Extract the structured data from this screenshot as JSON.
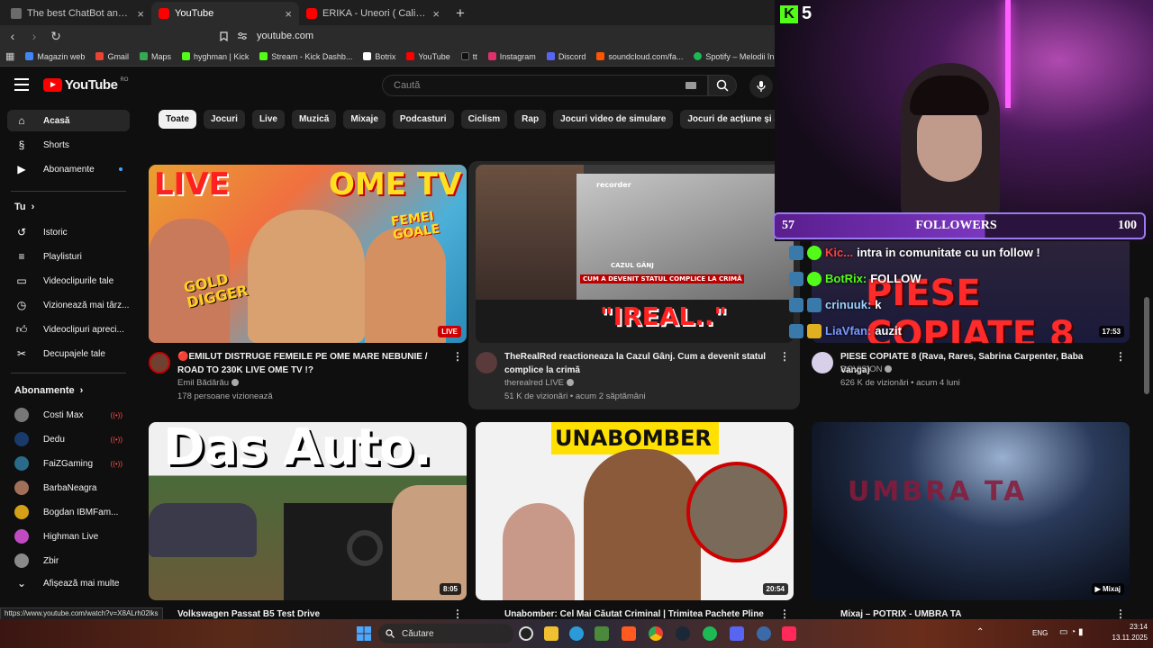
{
  "browser": {
    "tabs": [
      {
        "title": "The best ChatBot and Widgets for Kick",
        "color": "#6b6b6b"
      },
      {
        "title": "YouTube",
        "color": "#ff0000"
      },
      {
        "title": "ERIKA - Uneori ( Calinacho cover ) - YouTube",
        "color": "#ff0000"
      }
    ],
    "address": "youtube.com",
    "bookmarks": [
      {
        "label": "Magazin web",
        "color": "#4285f4"
      },
      {
        "label": "Gmail",
        "color": "#ea4335"
      },
      {
        "label": "Maps",
        "color": "#34a853"
      },
      {
        "label": "hyghman | Kick",
        "color": "#53fc18"
      },
      {
        "label": "Stream - Kick Dashb...",
        "color": "#53fc18"
      },
      {
        "label": "Botrix",
        "color": "#ffffff"
      },
      {
        "label": "YouTube",
        "color": "#ff0000"
      },
      {
        "label": "tt",
        "color": "#111111"
      },
      {
        "label": "Instagram",
        "color": "#e1306c"
      },
      {
        "label": "Discord",
        "color": "#5865f2"
      },
      {
        "label": "soundcloud.com/fa...",
        "color": "#ff5500"
      },
      {
        "label": "Spotify – Melodii în...",
        "color": "#1db954"
      }
    ]
  },
  "masthead": {
    "logo": "YouTube",
    "country": "RO",
    "search_placeholder": "Caută"
  },
  "sidebar": {
    "main": [
      {
        "label": "Acasă",
        "icon": "home-icon"
      },
      {
        "label": "Shorts",
        "icon": "shorts-icon"
      },
      {
        "label": "Abonamente",
        "icon": "subscriptions-icon"
      }
    ],
    "you_heading": "Tu",
    "you": [
      {
        "label": "Istoric",
        "icon": "history-icon"
      },
      {
        "label": "Playlisturi",
        "icon": "playlist-icon"
      },
      {
        "label": "Videoclipurile tale",
        "icon": "your-videos-icon"
      },
      {
        "label": "Vizionează mai târz...",
        "icon": "watch-later-icon"
      },
      {
        "label": "Videoclipuri apreci...",
        "icon": "liked-icon"
      },
      {
        "label": "Decupajele tale",
        "icon": "clips-icon"
      }
    ],
    "subs_heading": "Abonamente",
    "subs": [
      {
        "label": "Costi Max",
        "color": "#777777",
        "live": "((•))"
      },
      {
        "label": "Dedu",
        "color": "#1a3a6a",
        "live": "((•))"
      },
      {
        "label": "FaiZGaming",
        "color": "#2a6a8a",
        "live": "((•))"
      },
      {
        "label": "BarbaNeagra",
        "color": "#a0705a",
        "live": ""
      },
      {
        "label": "Bogdan IBMFam...",
        "color": "#d4a017",
        "live": ""
      },
      {
        "label": "Highman Live",
        "color": "#c04ac0",
        "live": ""
      },
      {
        "label": "Zbir",
        "color": "#8a8a8a",
        "live": ""
      }
    ],
    "show_more": "Afișează mai multe"
  },
  "chips": [
    "Toate",
    "Jocuri",
    "Live",
    "Muzică",
    "Mixaje",
    "Podcasturi",
    "Ciclism",
    "Rap",
    "Jocuri video de simulare",
    "Jocuri de acțiune și aventură"
  ],
  "videos": [
    {
      "title": "🔴EMILUT DISTRUGE FEMEILE PE OME MARE NEBUNIE / ROAD TO 230K LIVE OME TV !?",
      "channel": "Emil Bădărău",
      "stats": "178 persoane vizionează",
      "badge": "LIVE",
      "overlay": [
        "LIVE",
        "OME TV",
        "FEMEI GOALE",
        "GOLD DIGGER"
      ]
    },
    {
      "title": "TheRealRed reactioneaza la Cazul Gânj. Cum a devenit statul complice la crimă",
      "channel": "therealred LIVE",
      "stats": "51 K de vizionări • acum 2 săptămâni",
      "badge": "",
      "overlay": [
        "recorder",
        "CAZUL GÂNJ",
        "CUM A DEVENIT STATUL COMPLICE LA CRIMĂ",
        "\"IREAL..\""
      ]
    },
    {
      "title": "PIESE COPIATE 8 (Rava, Rares, Sabrina Carpenter, Baba Vanga)",
      "channel": "ROVISION",
      "stats": "626 K de vizionări • acum 4 luni",
      "badge": "17:53",
      "overlay": [
        "PIESE COPIATE 8"
      ]
    },
    {
      "title": "Volkswagen Passat B5 Test Drive",
      "channel": "",
      "stats": "",
      "badge": "8:05",
      "overlay": [
        "Das Auto."
      ]
    },
    {
      "title": "Unabomber: Cel Mai Căutat Criminal | Trimitea Pachete Pline",
      "channel": "",
      "stats": "",
      "badge": "20:54",
      "overlay": [
        "UNABOMBER"
      ]
    },
    {
      "title": "Mixaj – POTRIX - UMBRA TA",
      "channel": "",
      "stats": "",
      "badge": "Mixaj",
      "overlay": [
        "UMBRA TA"
      ]
    }
  ],
  "stream": {
    "kick_count": "5",
    "followers_current": "57",
    "followers_label": "FOLLOWERS",
    "followers_goal": "100",
    "followers_progress": 0.57,
    "chat": [
      {
        "user": "Kic...",
        "text": "intra in comunitate cu un follow !"
      },
      {
        "user": "BotRix:",
        "text": "FOLLOW"
      },
      {
        "user": "crinuuk:",
        "text": "k"
      },
      {
        "user": "LiaVfan:",
        "text": "auzit"
      }
    ]
  },
  "status_url": "https://www.youtube.com/watch?v=X8ALrh02lks",
  "taskbar": {
    "search": "Căutare",
    "lang": "ENG",
    "time": "23:14",
    "date": "13.11.2025"
  }
}
